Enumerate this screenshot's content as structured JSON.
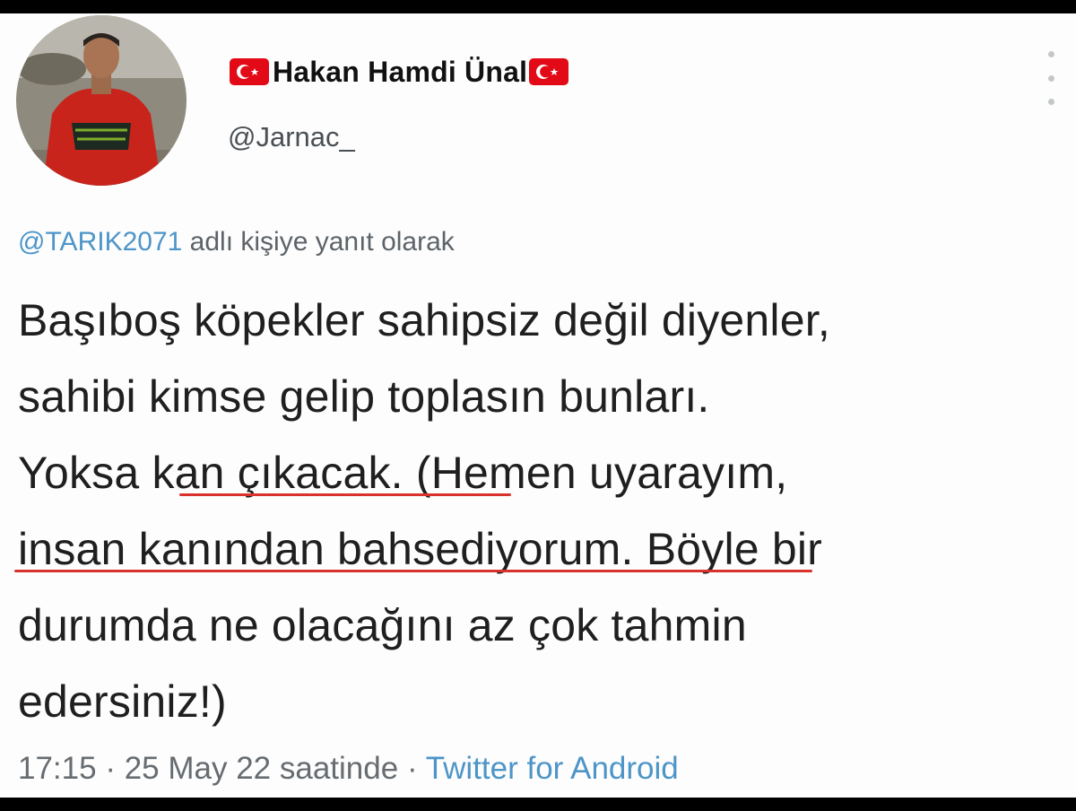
{
  "profile": {
    "display_name": "Hakan Hamdi Ünal",
    "handle": "@Jarnac_",
    "avatar_icon": "profile-photo-man-red-jacket"
  },
  "flag_icon": "turkey-flag-icon",
  "flag_colors": {
    "red": "#e30a17",
    "white": "#ffffff"
  },
  "menu": {
    "icon": "vertical-ellipsis-icon"
  },
  "reply": {
    "mention": "@TARIK2071",
    "suffix": "adlı kişiye yanıt olarak"
  },
  "tweet": {
    "lines": [
      "Başıboş köpekler sahipsiz değil diyenler,",
      "sahibi kimse gelip toplasın bunları.",
      "Yoksa kan çıkacak. (Hemen uyarayım,",
      "insan kanından bahsediyorum. Böyle bir",
      "durumda ne olacağını az çok tahmin",
      "edersiniz!)"
    ],
    "highlight_color": "#d8322b"
  },
  "meta": {
    "time": "17:15",
    "date": "25 May 22 saatinde",
    "separator": "·",
    "source": "Twitter for Android"
  },
  "colors": {
    "background": "#fdfdfd",
    "link_blue": "#4d95c8",
    "text": "#1f1f1f",
    "secondary_text": "#5d6368"
  }
}
